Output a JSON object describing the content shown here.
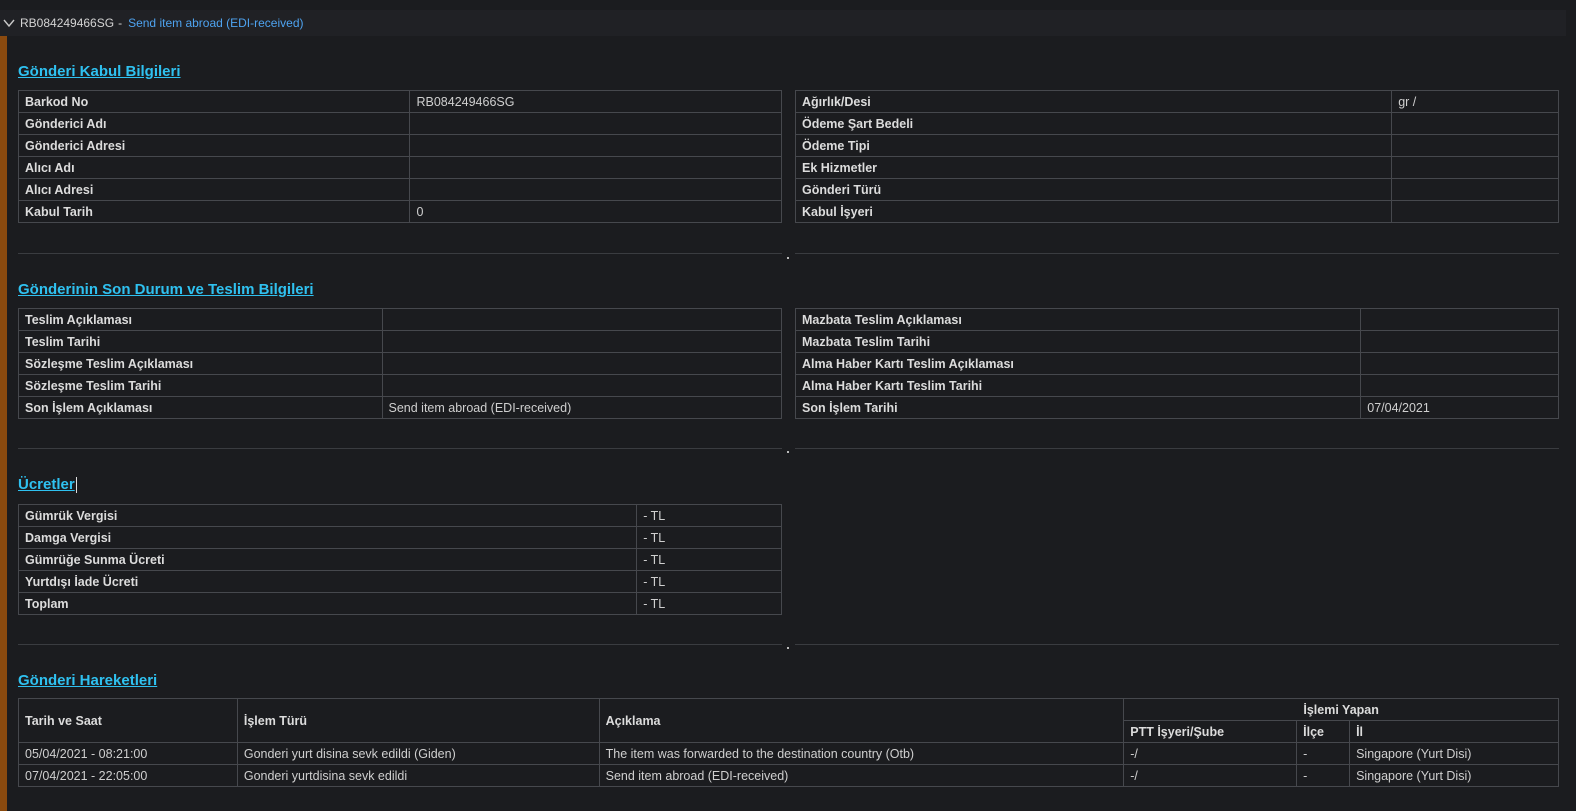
{
  "header": {
    "barcode": "RB084249466SG",
    "separator": "-",
    "status": "Send item abroad (EDI-received)"
  },
  "kabul": {
    "title": "Gönderi Kabul Bilgileri",
    "left": [
      {
        "label": "Barkod No",
        "value": "RB084249466SG"
      },
      {
        "label": "Gönderici Adı",
        "value": ""
      },
      {
        "label": "Gönderici Adresi",
        "value": ""
      },
      {
        "label": "Alıcı Adı",
        "value": ""
      },
      {
        "label": "Alıcı Adresi",
        "value": ""
      },
      {
        "label": "Kabul Tarih",
        "value": "0"
      }
    ],
    "right": [
      {
        "label": "Ağırlık/Desi",
        "value": "gr /"
      },
      {
        "label": "Ödeme Şart Bedeli",
        "value": ""
      },
      {
        "label": "Ödeme Tipi",
        "value": ""
      },
      {
        "label": "Ek Hizmetler",
        "value": ""
      },
      {
        "label": "Gönderi Türü",
        "value": ""
      },
      {
        "label": "Kabul İşyeri",
        "value": ""
      }
    ]
  },
  "teslim": {
    "title": "Gönderinin Son Durum ve Teslim Bilgileri",
    "left": [
      {
        "label": "Teslim Açıklaması",
        "value": ""
      },
      {
        "label": "Teslim Tarihi",
        "value": ""
      },
      {
        "label": "Sözleşme Teslim Açıklaması",
        "value": ""
      },
      {
        "label": "Sözleşme Teslim Tarihi",
        "value": ""
      },
      {
        "label": "Son İşlem Açıklaması",
        "value": "Send item abroad (EDI-received)"
      }
    ],
    "right": [
      {
        "label": "Mazbata Teslim Açıklaması",
        "value": ""
      },
      {
        "label": "Mazbata Teslim Tarihi",
        "value": ""
      },
      {
        "label": "Alma Haber Kartı Teslim Açıklaması",
        "value": ""
      },
      {
        "label": "Alma Haber Kartı Teslim Tarihi",
        "value": ""
      },
      {
        "label": "Son İşlem Tarihi",
        "value": "07/04/2021"
      }
    ]
  },
  "ucretler": {
    "title": "Ücretler",
    "rows": [
      {
        "label": "Gümrük Vergisi",
        "value": "- TL"
      },
      {
        "label": "Damga Vergisi",
        "value": "- TL"
      },
      {
        "label": "Gümrüğe Sunma Ücreti",
        "value": "- TL"
      },
      {
        "label": "Yurtdışı İade Ücreti",
        "value": "- TL"
      },
      {
        "label": "Toplam",
        "value": "- TL"
      }
    ]
  },
  "hareketler": {
    "title": "Gönderi Hareketleri",
    "headers": {
      "date": "Tarih ve Saat",
      "type": "İşlem Türü",
      "desc": "Açıklama",
      "actor": "İşlemi Yapan",
      "branch": "PTT İşyeri/Şube",
      "district": "İlçe",
      "city": "İl"
    },
    "rows": [
      {
        "date": "05/04/2021 - 08:21:00",
        "type": "Gonderi yurt disina sevk edildi (Giden)",
        "desc": "The item was forwarded to the destination country (Otb)",
        "branch": "-/",
        "district": "-",
        "city": "Singapore (Yurt Disi)"
      },
      {
        "date": "07/04/2021 - 22:05:00",
        "type": "Gonderi yurtdisina sevk edildi",
        "desc": "Send item abroad (EDI-received)",
        "branch": "-/",
        "district": "-",
        "city": "Singapore (Yurt Disi)"
      }
    ]
  }
}
